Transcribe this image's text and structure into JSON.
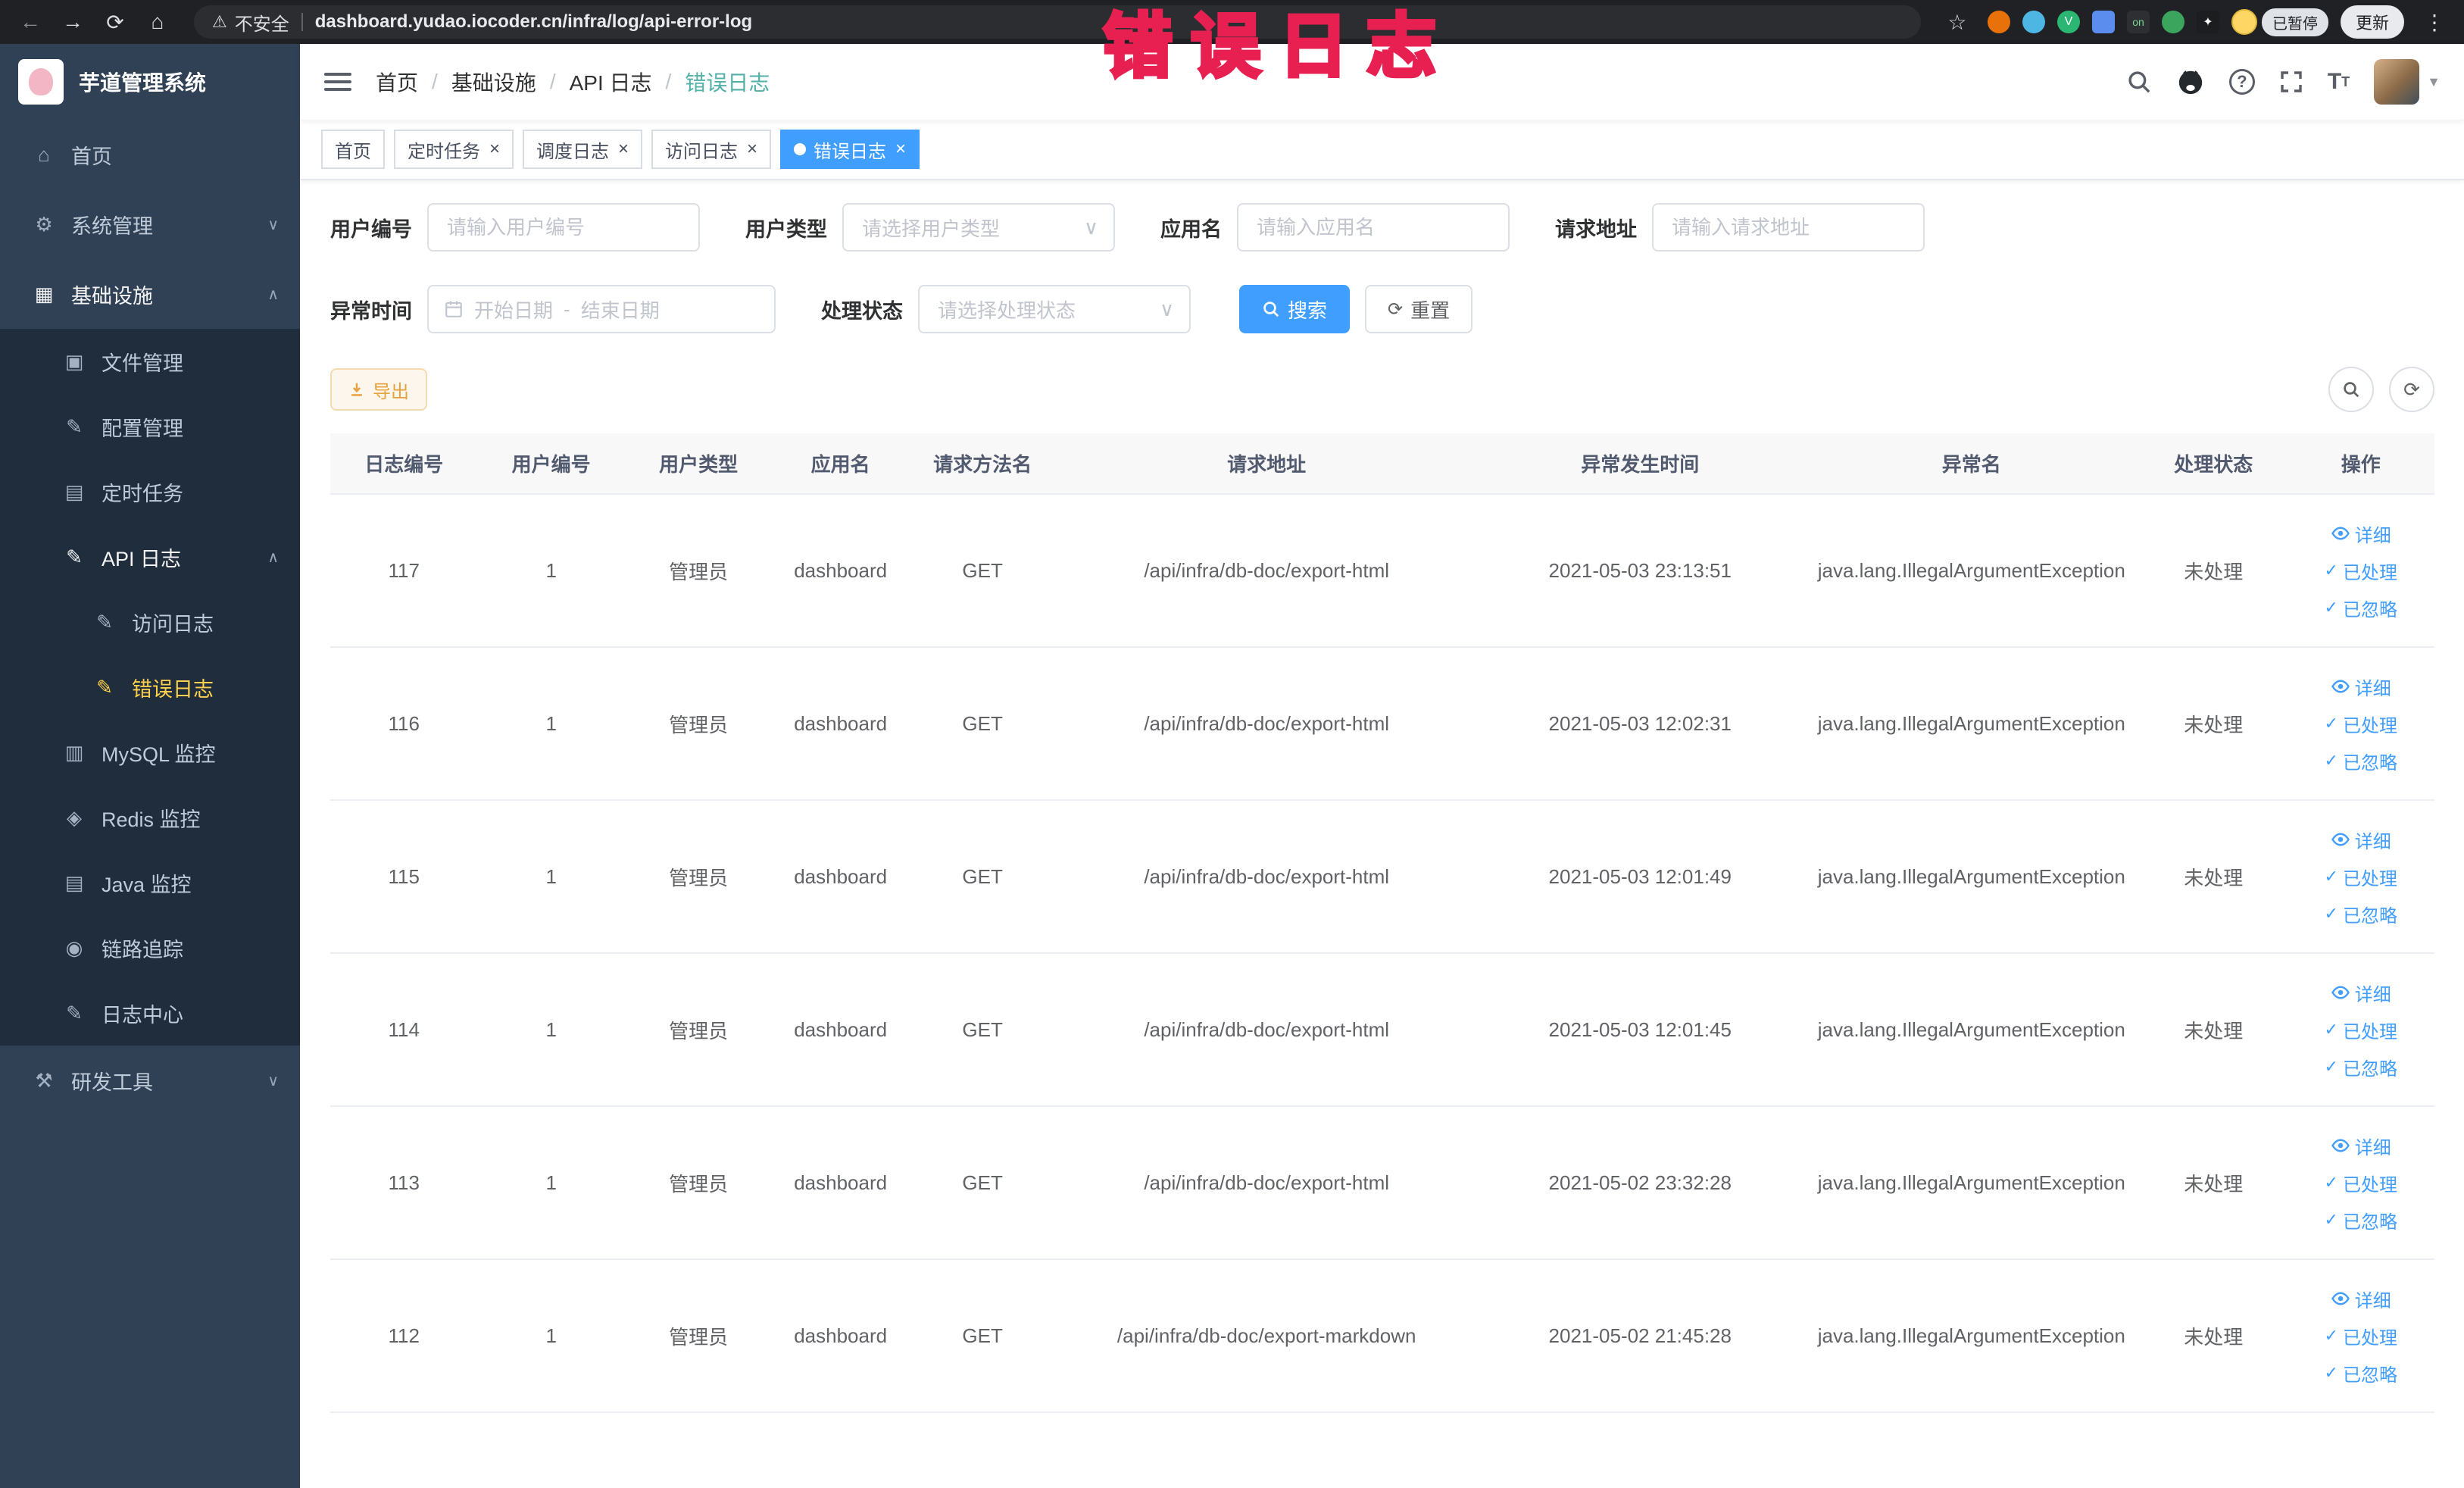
{
  "browser": {
    "security_warning": "不安全",
    "url": "dashboard.yudao.iocoder.cn/infra/log/api-error-log",
    "paused_badge": "已暂停",
    "update_button": "更新"
  },
  "annotation": {
    "text": "错误日志"
  },
  "colors": {
    "accent": "#409eff",
    "sidebar_bg": "#304156",
    "active_menu": "#ffd04b",
    "annotation": "#e82052",
    "warning_btn": "#e6a23c"
  },
  "sidebar": {
    "logo_title": "芋道管理系统",
    "items": [
      {
        "label": "首页"
      },
      {
        "label": "系统管理"
      },
      {
        "label": "基础设施"
      },
      {
        "label": "文件管理"
      },
      {
        "label": "配置管理"
      },
      {
        "label": "定时任务"
      },
      {
        "label": "API 日志"
      },
      {
        "label": "访问日志"
      },
      {
        "label": "错误日志"
      },
      {
        "label": "MySQL 监控"
      },
      {
        "label": "Redis 监控"
      },
      {
        "label": "Java 监控"
      },
      {
        "label": "链路追踪"
      },
      {
        "label": "日志中心"
      },
      {
        "label": "研发工具"
      }
    ]
  },
  "header": {
    "breadcrumb": [
      "首页",
      "基础设施",
      "API 日志",
      "错误日志"
    ]
  },
  "tabs": [
    {
      "label": "首页"
    },
    {
      "label": "定时任务"
    },
    {
      "label": "调度日志"
    },
    {
      "label": "访问日志"
    },
    {
      "label": "错误日志"
    }
  ],
  "filters": {
    "user_id_label": "用户编号",
    "user_id_placeholder": "请输入用户编号",
    "user_type_label": "用户类型",
    "user_type_placeholder": "请选择用户类型",
    "app_name_label": "应用名",
    "app_name_placeholder": "请输入应用名",
    "request_url_label": "请求地址",
    "request_url_placeholder": "请输入请求地址",
    "exception_time_label": "异常时间",
    "start_date_placeholder": "开始日期",
    "end_date_placeholder": "结束日期",
    "date_separator": "-",
    "process_status_label": "处理状态",
    "process_status_placeholder": "请选择处理状态",
    "search_button": "搜索",
    "reset_button": "重置"
  },
  "toolbar": {
    "export_label": "导出"
  },
  "table": {
    "columns": [
      "日志编号",
      "用户编号",
      "用户类型",
      "应用名",
      "请求方法名",
      "请求地址",
      "异常发生时间",
      "异常名",
      "处理状态",
      "操作"
    ],
    "actions": {
      "detail": "详细",
      "processed": "已处理",
      "ignored": "已忽略"
    },
    "rows": [
      {
        "log_id": "117",
        "user_id": "1",
        "user_type": "管理员",
        "app_name": "dashboard",
        "method": "GET",
        "url": "/api/infra/db-doc/export-html",
        "time": "2021-05-03 23:13:51",
        "exception": "java.lang.IllegalArgumentException",
        "status": "未处理"
      },
      {
        "log_id": "116",
        "user_id": "1",
        "user_type": "管理员",
        "app_name": "dashboard",
        "method": "GET",
        "url": "/api/infra/db-doc/export-html",
        "time": "2021-05-03 12:02:31",
        "exception": "java.lang.IllegalArgumentException",
        "status": "未处理"
      },
      {
        "log_id": "115",
        "user_id": "1",
        "user_type": "管理员",
        "app_name": "dashboard",
        "method": "GET",
        "url": "/api/infra/db-doc/export-html",
        "time": "2021-05-03 12:01:49",
        "exception": "java.lang.IllegalArgumentException",
        "status": "未处理"
      },
      {
        "log_id": "114",
        "user_id": "1",
        "user_type": "管理员",
        "app_name": "dashboard",
        "method": "GET",
        "url": "/api/infra/db-doc/export-html",
        "time": "2021-05-03 12:01:45",
        "exception": "java.lang.IllegalArgumentException",
        "status": "未处理"
      },
      {
        "log_id": "113",
        "user_id": "1",
        "user_type": "管理员",
        "app_name": "dashboard",
        "method": "GET",
        "url": "/api/infra/db-doc/export-html",
        "time": "2021-05-02 23:32:28",
        "exception": "java.lang.IllegalArgumentException",
        "status": "未处理"
      },
      {
        "log_id": "112",
        "user_id": "1",
        "user_type": "管理员",
        "app_name": "dashboard",
        "method": "GET",
        "url": "/api/infra/db-doc/export-markdown",
        "time": "2021-05-02 21:45:28",
        "exception": "java.lang.IllegalArgumentException",
        "status": "未处理"
      }
    ]
  }
}
